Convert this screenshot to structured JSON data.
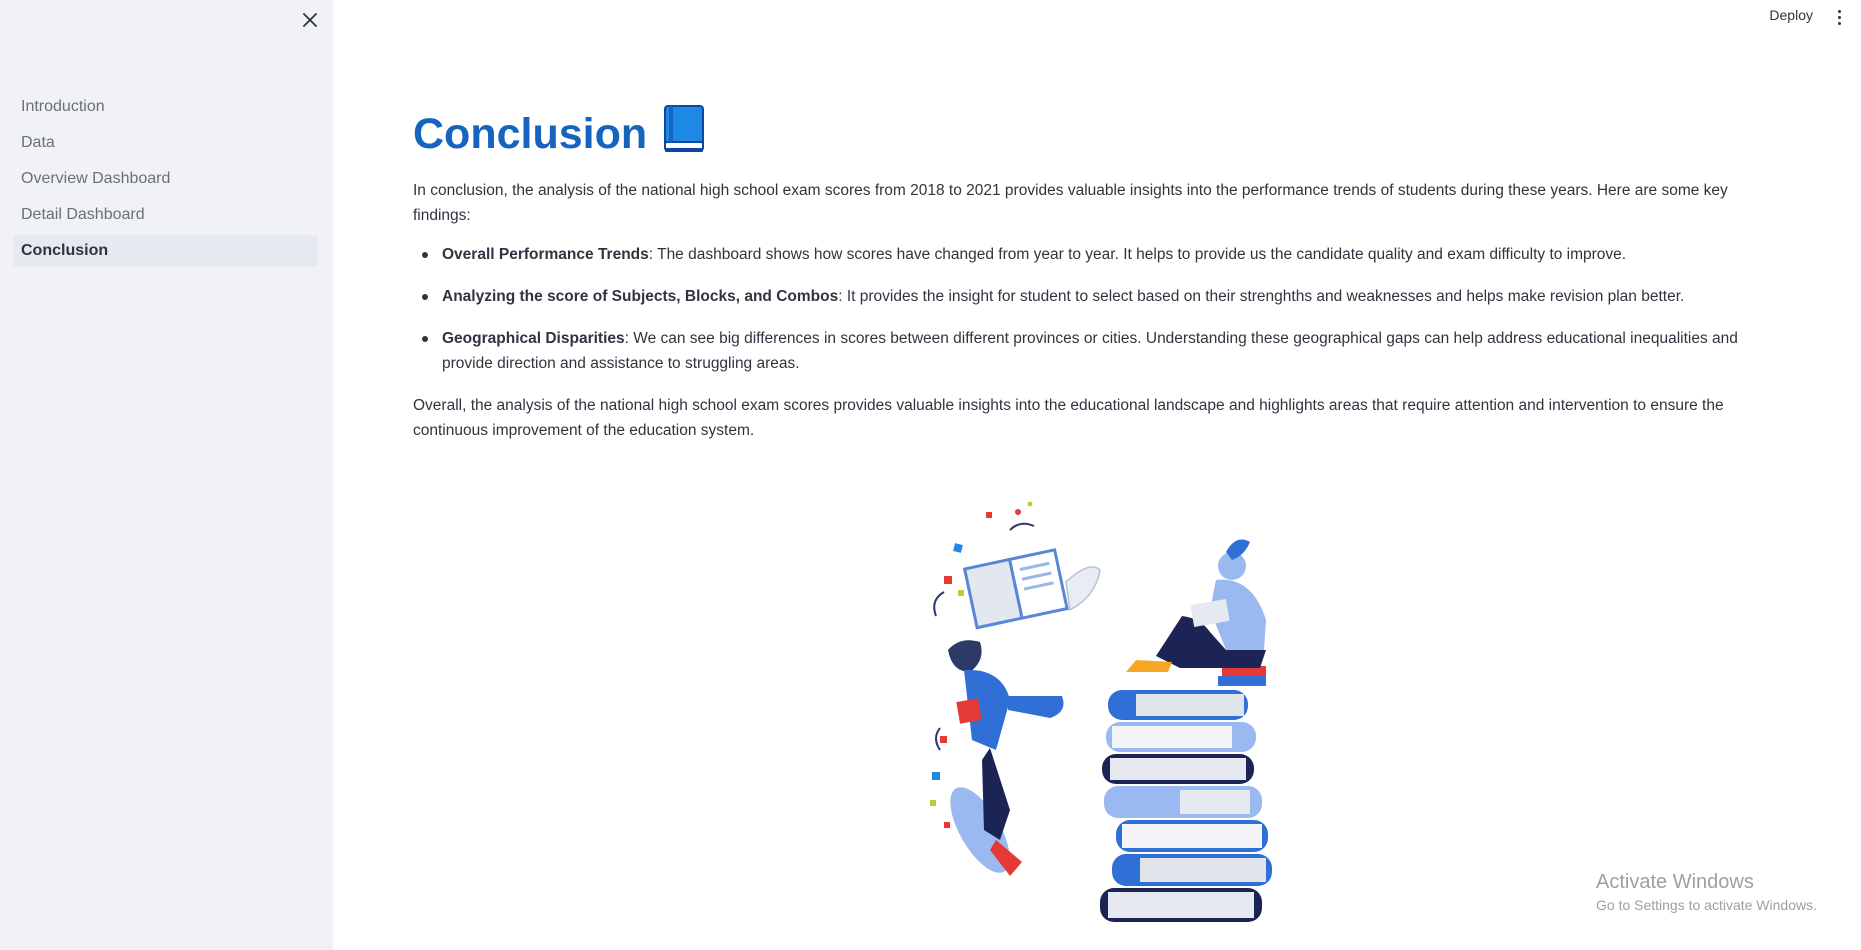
{
  "sidebar": {
    "items": [
      {
        "label": "Introduction",
        "active": false
      },
      {
        "label": "Data",
        "active": false
      },
      {
        "label": "Overview Dashboard",
        "active": false
      },
      {
        "label": "Detail Dashboard",
        "active": false
      },
      {
        "label": "Conclusion",
        "active": true
      }
    ]
  },
  "header": {
    "deploy_label": "Deploy"
  },
  "main": {
    "title": "Conclusion",
    "title_emoji": "blue-book-icon",
    "intro": "In conclusion, the analysis of the national high school exam scores from 2018 to 2021 provides valuable insights into the performance trends of students during these years. Here are some key findings:",
    "findings": [
      {
        "bold": "Overall Performance Trends",
        "text": ": The dashboard shows how scores have changed from year to year. It helps to provide us the candidate quality and exam difficulty to improve."
      },
      {
        "bold": "Analyzing the score of Subjects, Blocks, and Combos",
        "text": ": It provides the insight for student to select based on their strenghths and weaknesses and helps make revision plan better."
      },
      {
        "bold": "Geographical Disparities",
        "text": ": We can see big differences in scores between different provinces or cities. Understanding these geographical gaps can help address educational inequalities and provide direction and assistance to struggling areas."
      }
    ],
    "summary": "Overall, the analysis of the national high school exam scores provides valuable insights into the educational landscape and highlights areas that require attention and intervention to ensure the continuous improvement of the education system.",
    "illustration": "students-studying-books-illustration"
  },
  "watermark": {
    "line1": "Activate Windows",
    "line2": "Go to Settings to activate Windows."
  },
  "colors": {
    "accent": "#1565c0",
    "sidebar_bg": "#f0f2f6",
    "text": "#31333f"
  }
}
